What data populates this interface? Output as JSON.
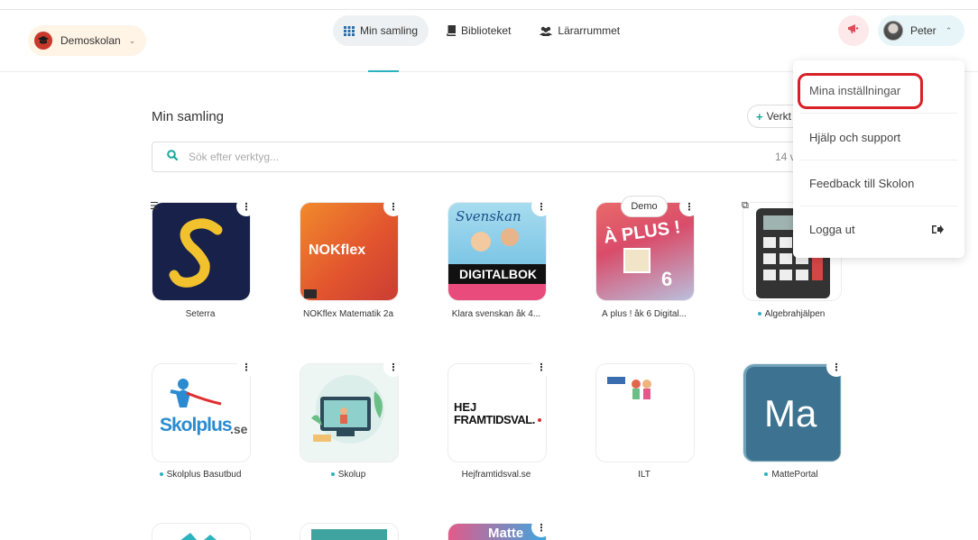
{
  "header": {
    "school": "Demoskolan",
    "nav": [
      {
        "label": "Min samling",
        "active": true
      },
      {
        "label": "Biblioteket",
        "active": false
      },
      {
        "label": "Lärarrummet",
        "active": false
      }
    ],
    "user": "Peter"
  },
  "main": {
    "title": "Min samling",
    "add_tool": "Verkt",
    "search_placeholder": "Sök efter verktyg...",
    "search_count": "14 v"
  },
  "tiles": [
    {
      "label": "Seterra",
      "dot": false
    },
    {
      "label": "NOKflex Matematik 2a",
      "dot": false
    },
    {
      "label": "Klara svenskan åk 4...",
      "dot": false
    },
    {
      "label": "À plus ! åk 6 Digital...",
      "dot": false,
      "badge": "Demo"
    },
    {
      "label": "Algebrahjälpen",
      "dot": true
    },
    {
      "label": "Skolplus Basutbud",
      "dot": true
    },
    {
      "label": "Skolup",
      "dot": true
    },
    {
      "label": "Hejframtidsval.se",
      "dot": false
    },
    {
      "label": "ILT",
      "dot": false
    },
    {
      "label": "MattePortal",
      "dot": true
    }
  ],
  "tile_art": {
    "nokflex": "NOKflex",
    "svenskan": "Svenskan",
    "digitalbok": "DIGITALBOK",
    "aplus": "À PLUS !",
    "aplus_num": "6",
    "skolplus": "Skolplus",
    "skolplus_tld": ".se",
    "hej_line1": "HEJ",
    "hej_line2": "FRAMTIDSVAL.",
    "ma": "Ma",
    "matte": "Matte"
  },
  "dropdown": [
    "Mina inställningar",
    "Hjälp och support",
    "Feedback till Skolon",
    "Logga ut"
  ],
  "colors": {
    "accent": "#2bb3c0",
    "highlight": "#d92027",
    "school_bg": "#fff4e6",
    "user_bg": "#e8f5f8"
  }
}
